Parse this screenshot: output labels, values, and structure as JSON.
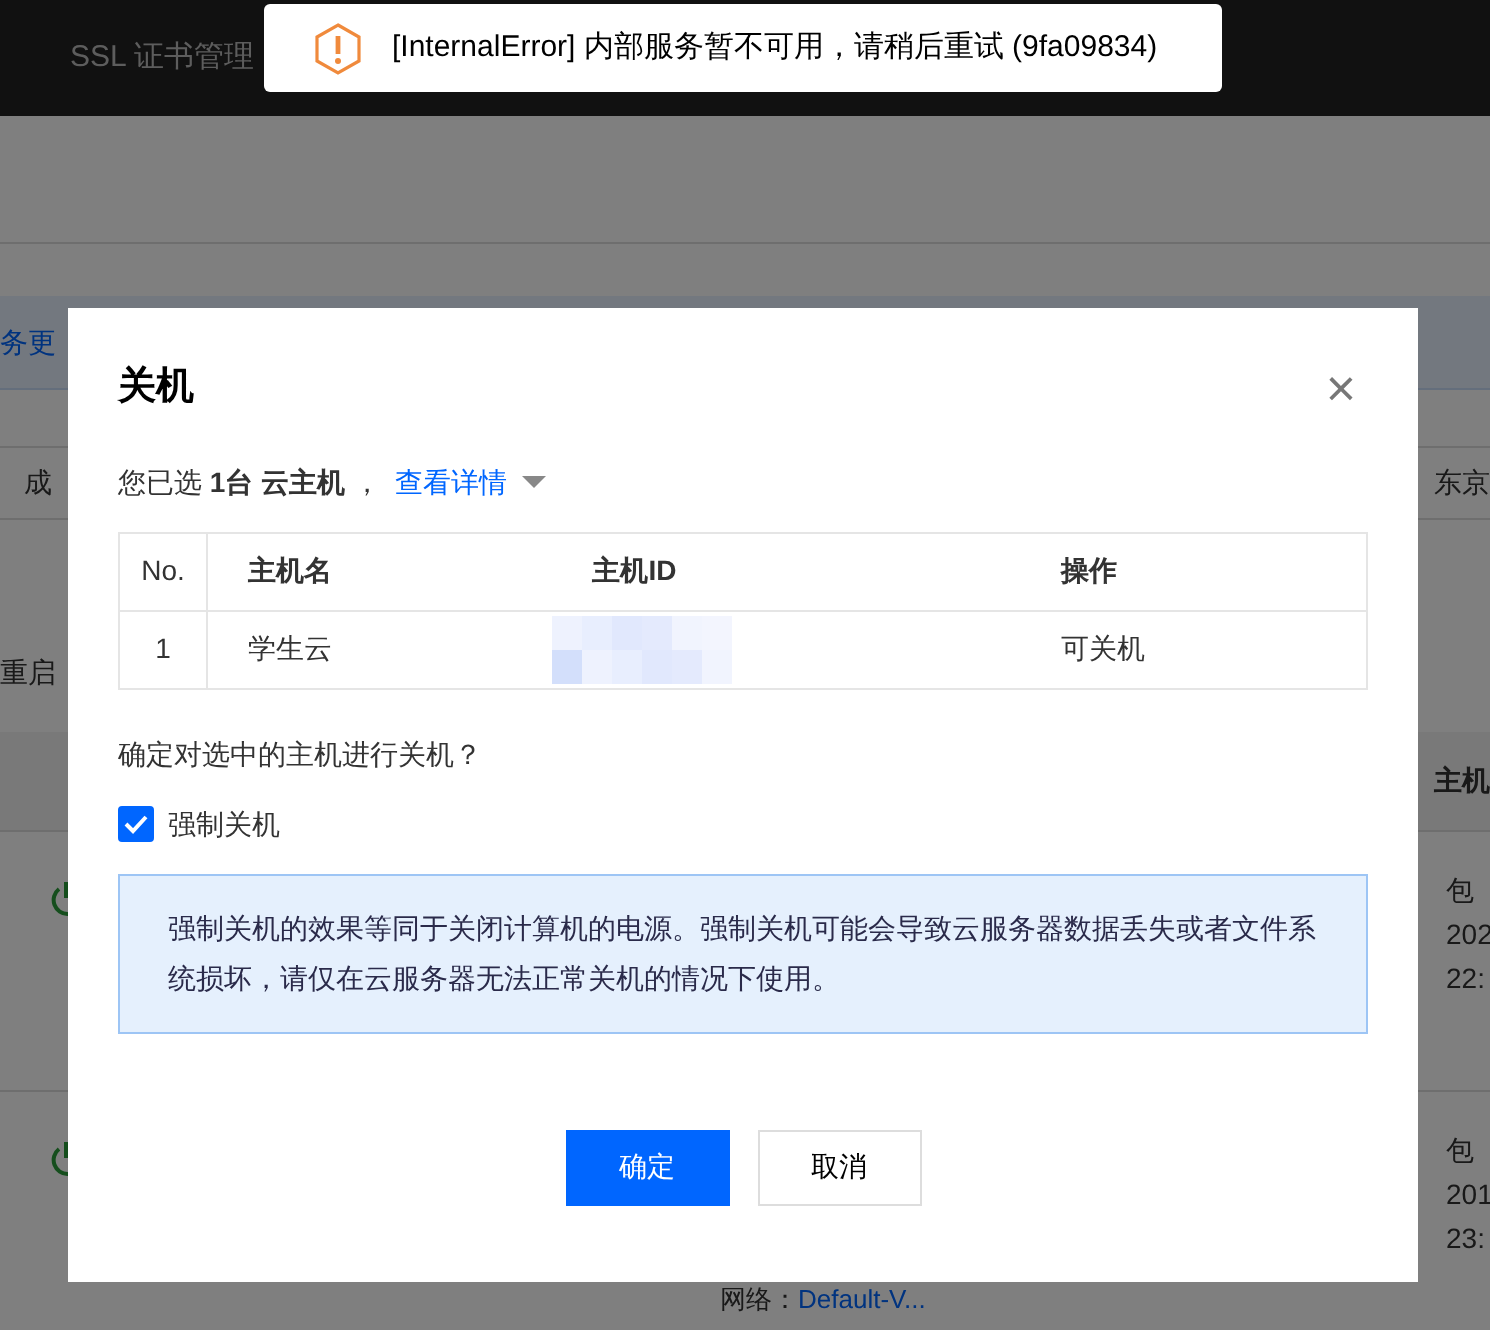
{
  "background_page": {
    "nav": [
      "SSL 证书管理"
    ],
    "banner": "务更",
    "region_left": "成",
    "region_right": "东京",
    "action": "重启",
    "headers": [
      "主机"
    ],
    "rows": [
      {
        "lines": [
          "包",
          "202",
          "22:"
        ]
      },
      {
        "lines": [
          "包",
          "201",
          "23:"
        ],
        "network_label": "网络：",
        "network_link": "Default-V..."
      }
    ]
  },
  "toast": {
    "kind": "warning",
    "message": "[InternalError] 内部服务暂不可用，请稍后重试 (9fa09834)"
  },
  "dialog": {
    "title": "关机",
    "close": "×",
    "summary": "您已选 **1台 云主机** ，",
    "details_link": "查看详情",
    "table": {
      "columns": [
        "No.",
        "主机名",
        "主机ID",
        "操作"
      ],
      "rows": [
        {
          "no": "1",
          "name": "学生云",
          "action": "可关机"
        }
      ]
    },
    "question": "确定对选中的主机进行关机？",
    "force": {
      "label": "强制关机",
      "checked": true
    },
    "notice": "强制关机的效果等同于关闭计算机的电源。强制关机可能会导致云服务器数据丢失或者文件系统损坏，请仅在云服务器无法正常关机的情况下使用。",
    "buttons": [
      {
        "label": "确定",
        "kind": "primary"
      },
      {
        "label": "取消",
        "kind": "secondary"
      }
    ]
  }
}
